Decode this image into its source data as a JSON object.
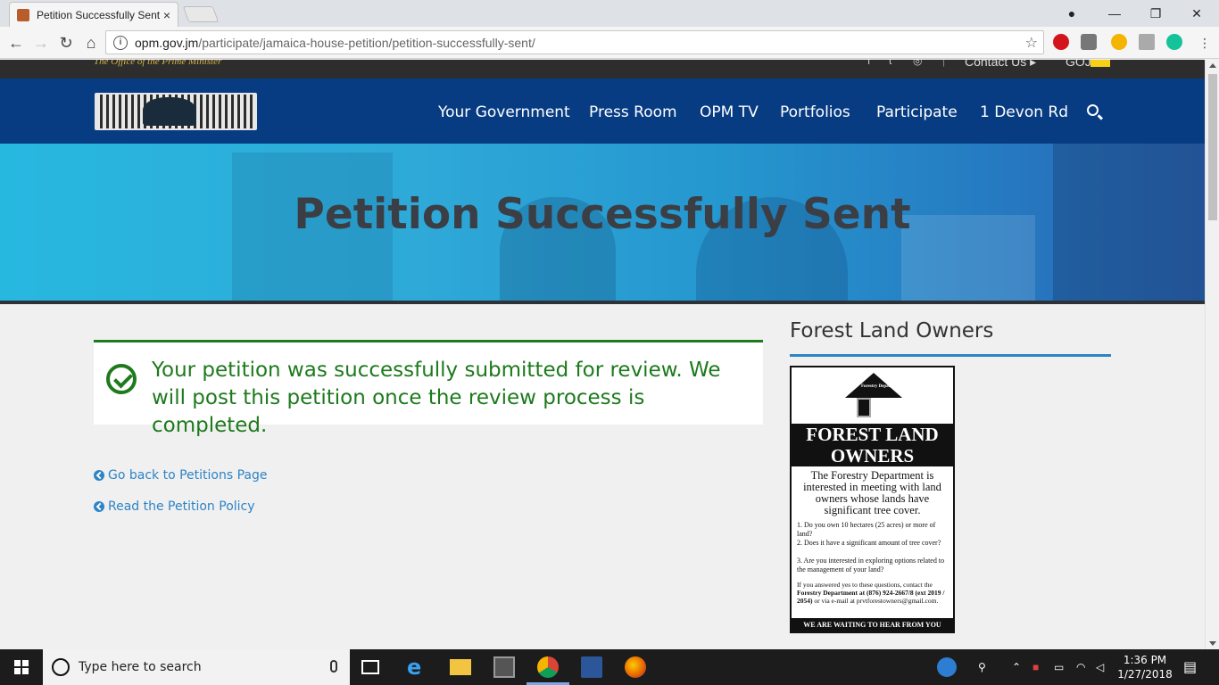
{
  "browser": {
    "tab_title": "Petition Successfully Sent",
    "tab_close": "×",
    "url_host": "opm.gov.jm",
    "url_path": "/participate/jamaica-house-petition/petition-successfully-sent/",
    "info_icon": "i",
    "star_icon": "☆",
    "back_icon": "←",
    "forward_icon": "→",
    "reload_icon": "↻",
    "home_icon": "⌂",
    "minimize_icon": "—",
    "restore_icon": "❐",
    "close_icon": "✕",
    "profile_icon": "●"
  },
  "site": {
    "tagline": "The Office of the Prime Minister",
    "social_icons": [
      "f",
      "t",
      "◎"
    ],
    "contact_label": "Contact Us ▸",
    "goj_label": "GOJ",
    "nav": [
      "Your Government",
      "Press Room",
      "OPM TV",
      "Portfolios",
      "Participate",
      "1 Devon Rd"
    ],
    "hero_title": "Petition Successfully Sent"
  },
  "main": {
    "success_message": "Your petition was successfully submitted for review. We will post this petition once the review process is completed.",
    "links": [
      "Go back to Petitions Page",
      "Read the Petition Policy"
    ]
  },
  "sidebar": {
    "heading": "Forest Land Owners",
    "poster": {
      "dept": "Forestry Department",
      "banner_line1": "FOREST LAND",
      "banner_line2": "OWNERS",
      "intro": "The Forestry Department is interested in meeting with land owners whose lands have significant tree cover.",
      "q1": "1. Do you own 10 hectares (25 acres) or more of land?",
      "q2": "2. Does it have a significant amount of tree cover?",
      "q3": "3. Are you interested in exploring options related to the management of your land?",
      "foot_text": "If you answered yes to these questions, contact the",
      "foot_dept": "Forestry Department",
      "foot_phone": "at (876) 924-2667/8 (ext 2019 / 2054)",
      "foot_email": "or via e-mail at prvtforestowners@gmail.com.",
      "footbar": "WE ARE WAITING TO HEAR FROM YOU"
    }
  },
  "taskbar": {
    "search_placeholder": "Type here to search",
    "time": "1:36 PM",
    "date": "1/27/2018"
  },
  "colors": {
    "nav_bg": "#083c82",
    "success_green": "#1d7a1d",
    "link_blue": "#2d84c6"
  }
}
